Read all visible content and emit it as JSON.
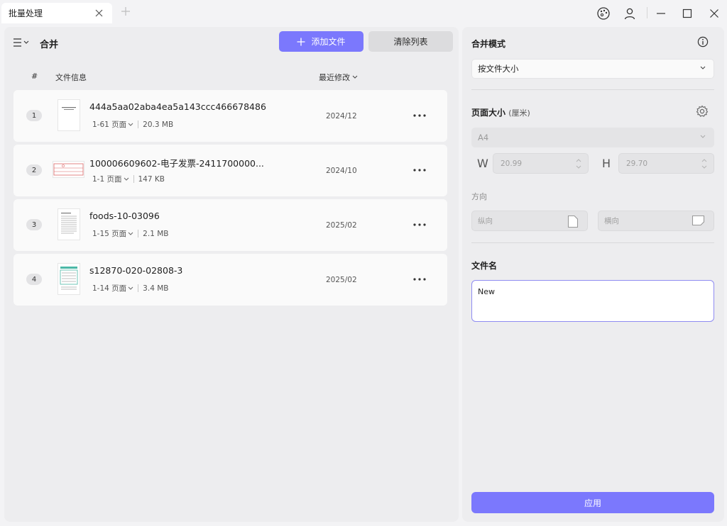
{
  "window": {
    "tab_title": "批量处理"
  },
  "left": {
    "title": "合并",
    "add_button": "添加文件",
    "clear_button": "清除列表",
    "columns": {
      "number": "#",
      "info": "文件信息",
      "modified": "最近修改"
    },
    "files": [
      {
        "index": "1",
        "name": "444a5aa02aba4ea5a143ccc466678486",
        "pages": "1-61 页面",
        "size": "20.3 MB",
        "date": "2024/12"
      },
      {
        "index": "2",
        "name": "100006609602-电子发票-2411700000...",
        "pages": "1-1 页面",
        "size": "147 KB",
        "date": "2024/10"
      },
      {
        "index": "3",
        "name": "foods-10-03096",
        "pages": "1-15 页面",
        "size": "2.1 MB",
        "date": "2025/02"
      },
      {
        "index": "4",
        "name": "s12870-020-02808-3",
        "pages": "1-14 页面",
        "size": "3.4 MB",
        "date": "2025/02"
      }
    ]
  },
  "right": {
    "merge_mode_label": "合并模式",
    "merge_mode_value": "按文件大小",
    "page_size_label": "页面大小",
    "page_size_unit": "(厘米)",
    "page_size_value": "A4",
    "width_label": "W",
    "width_value": "20.99",
    "height_label": "H",
    "height_value": "29.70",
    "orientation_label": "方向",
    "portrait_label": "纵向",
    "landscape_label": "横向",
    "filename_label": "文件名",
    "filename_value": "New",
    "apply_button": "应用"
  },
  "colors": {
    "accent": "#7b78fd",
    "panel": "#ededef",
    "row": "#fafafa"
  }
}
